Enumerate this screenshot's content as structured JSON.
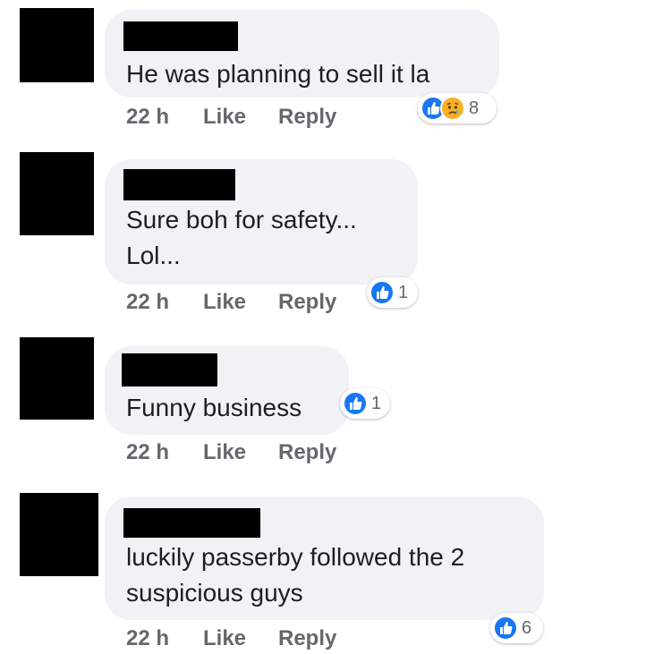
{
  "comments": [
    {
      "text": "He was planning to sell it la",
      "time": "22 h",
      "like": "Like",
      "reply": "Reply",
      "reaction_count": "8",
      "reaction_icons": [
        "like-icon",
        "sad-icon"
      ]
    },
    {
      "text": "Sure boh for safety...\nLol...",
      "time": "22 h",
      "like": "Like",
      "reply": "Reply",
      "reaction_count": "1",
      "reaction_icons": [
        "like-icon"
      ]
    },
    {
      "text": "Funny business",
      "time": "22 h",
      "like": "Like",
      "reply": "Reply",
      "reaction_count": "1",
      "reaction_icons": [
        "like-icon"
      ]
    },
    {
      "text": "luckily passerby followed the 2\nsuspicious guys",
      "time": "22 h",
      "like": "Like",
      "reply": "Reply",
      "reaction_count": "6",
      "reaction_icons": [
        "like-icon"
      ]
    }
  ],
  "colors": {
    "bubble": "#f0f2f5",
    "like_blue": "#1877f2",
    "sad_yellow": "#f7b125",
    "meta_gray": "#65676b"
  }
}
